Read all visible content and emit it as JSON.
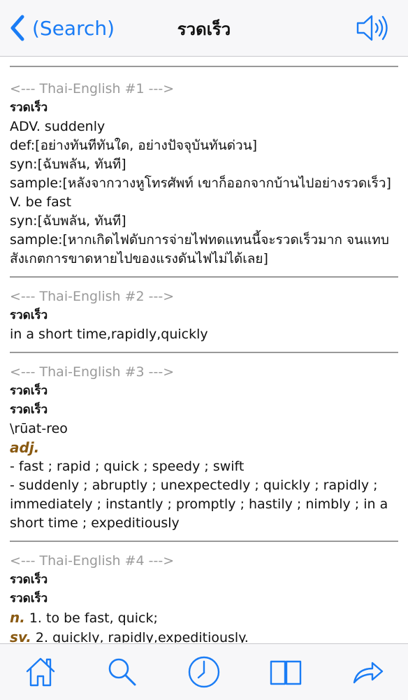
{
  "navbar": {
    "back_label": "(Search)",
    "title": "รวดเร็ว"
  },
  "entries": [
    {
      "header": "<--- Thai-English #1 --->",
      "headword": "รวดเร็ว",
      "lines": [
        "ADV. suddenly",
        "def:[อย่างทันทีทันใด, อย่างปัจจุบันทันด่วน]",
        "syn:[ฉับพลัน, ทันที]",
        "sample:[หลังจากวางหูโทรศัพท์ เขาก็ออกจากบ้านไปอย่างรวดเร็ว]",
        "V. be fast",
        "syn:[ฉับพลัน, ทันที]",
        "sample:[หากเกิดไฟดับการจ่ายไฟทดแทนนี้จะรวดเร็วมาก จนแทบ",
        "สังเกตการขาดหายไปของแรงดันไฟไม่ได้เลย]"
      ]
    },
    {
      "header": "<--- Thai-English #2 --->",
      "headword": "รวดเร็ว",
      "lines": [
        "in a short time,rapidly,quickly"
      ]
    },
    {
      "header": "<--- Thai-English #3 --->",
      "headword": "รวดเร็ว",
      "headword2": "รวดเร็ว",
      "pron": "\\rūat-reo",
      "pos": "adj.",
      "lines": [
        "- fast ; rapid ; quick ; speedy ; swift",
        "- suddenly ; abruptly ; unexpectedly ; quickly ; rapidly ;",
        "immediately ; instantly ; promptly ; hastily ; nimbly ; in a",
        "short time ; expeditiously"
      ]
    },
    {
      "header": "<--- Thai-English #4 --->",
      "headword": "รวดเร็ว",
      "headword2": "รวดเร็ว",
      "line1_pos": "n.",
      "line1_text": "1. to be fast, quick;",
      "line2_pos": "sv.",
      "line2_text": "2. quickly, rapidly,expeditiously."
    }
  ],
  "tabbar": {
    "icons": [
      "home-icon",
      "search-icon",
      "history-icon",
      "book-icon",
      "share-icon"
    ]
  },
  "colors": {
    "accent": "#1a7cf5",
    "pos": "#8a5a12",
    "header_gray": "#9a9a9a"
  }
}
